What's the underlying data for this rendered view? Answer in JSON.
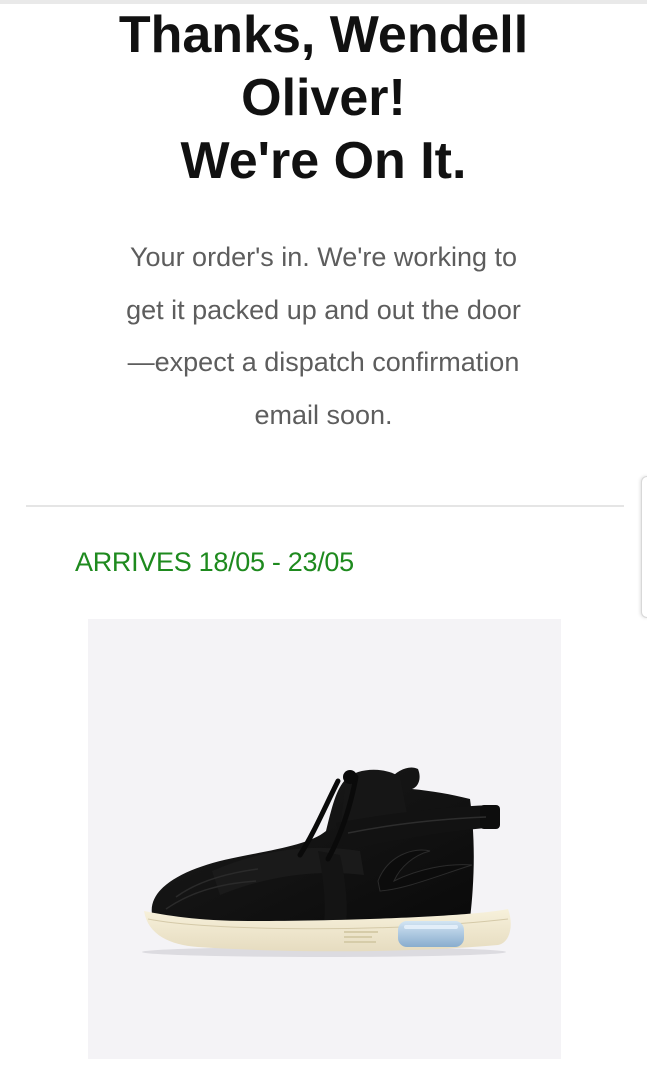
{
  "confirmation": {
    "headline_lines": [
      "Thanks, Wendell",
      "Oliver!",
      "We're On It."
    ],
    "message_lines": [
      "Your order's in. We're working to",
      "get it packed up and out the door",
      "—expect a dispatch confirmation",
      "email soon."
    ]
  },
  "shipment": {
    "arrival": "ARRIVES 18/05 - 23/05",
    "arrival_color": "#1e8a1e"
  },
  "product": {
    "image_icon": "black-high-top-sneaker-image",
    "card_background": "#f4f3f6"
  }
}
